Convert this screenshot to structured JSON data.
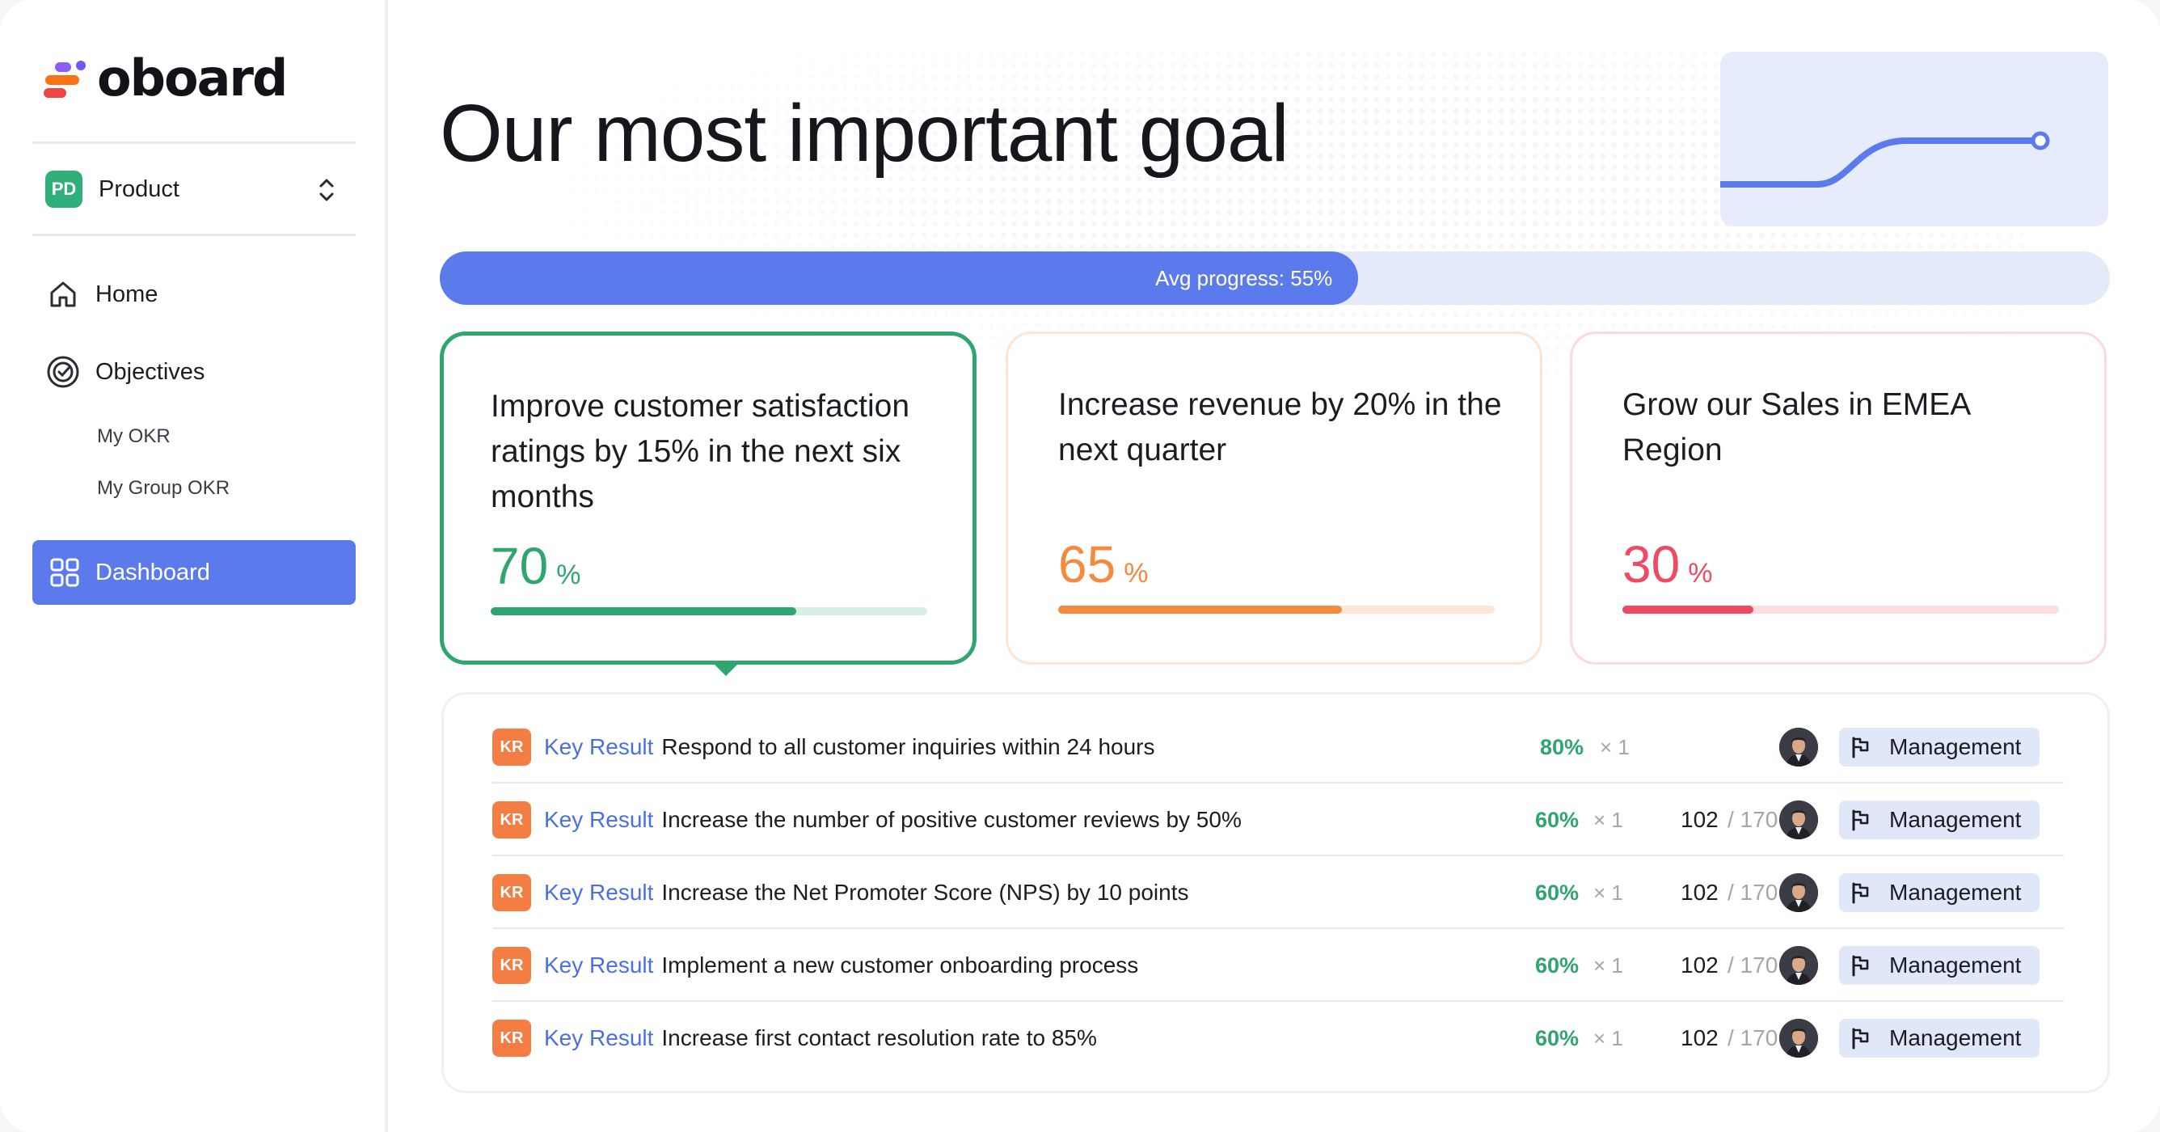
{
  "app": {
    "brand": "oboard",
    "workspace": {
      "badge": "PD",
      "name": "Product"
    }
  },
  "sidebar": {
    "items": [
      {
        "label": "Home",
        "icon": "home-icon"
      },
      {
        "label": "Objectives",
        "icon": "target-icon"
      }
    ],
    "sub_items": [
      {
        "label": "My OKR"
      },
      {
        "label": "My Group OKR"
      }
    ],
    "active": {
      "label": "Dashboard",
      "icon": "grid-icon"
    }
  },
  "main": {
    "title": "Our most important goal",
    "avg_progress": {
      "label": "Avg progress: 55%",
      "value": 55
    },
    "objectives": [
      {
        "title": "Improve customer satisfaction ratings by 15% in the next six months",
        "value": "70",
        "unit": "%",
        "progress": 70,
        "color": "#2fa56f",
        "track": "#d6f1e4"
      },
      {
        "title": "Increase revenue by 20% in the next quarter",
        "value": "65",
        "unit": "%",
        "progress": 65,
        "color": "#f58a3e",
        "track": "#fde6d6"
      },
      {
        "title": "Grow our Sales in EMEA Region",
        "value": "30",
        "unit": "%",
        "progress": 30,
        "color": "#ef4a62",
        "track": "#fcdde2"
      }
    ],
    "key_results": [
      {
        "badge": "KR",
        "type": "Key Result",
        "text": "Respond to all customer inquiries within 24 hours",
        "percent": "80%",
        "multiplier": "× 1",
        "current": "",
        "total": "",
        "tag": "Management"
      },
      {
        "badge": "KR",
        "type": "Key Result",
        "text": "Increase the number of positive customer reviews by 50%",
        "percent": "60%",
        "multiplier": "× 1",
        "current": "102",
        "total": "/ 170",
        "tag": "Management"
      },
      {
        "badge": "KR",
        "type": "Key Result",
        "text": "Increase the Net Promoter Score (NPS) by 10 points",
        "percent": "60%",
        "multiplier": "× 1",
        "current": "102",
        "total": "/ 170",
        "tag": "Management"
      },
      {
        "badge": "KR",
        "type": "Key Result",
        "text": "Implement a new customer onboarding process",
        "percent": "60%",
        "multiplier": "× 1",
        "current": "102",
        "total": "/ 170",
        "tag": "Management"
      },
      {
        "badge": "KR",
        "type": "Key Result",
        "text": "Increase first contact resolution rate to 85%",
        "percent": "60%",
        "multiplier": "× 1",
        "current": "102",
        "total": "/ 170",
        "tag": "Management"
      }
    ]
  },
  "colors": {
    "accent": "#5b7bed",
    "success": "#2fa56f",
    "kr_badge": "#f37d42",
    "link": "#4a6fe3"
  }
}
